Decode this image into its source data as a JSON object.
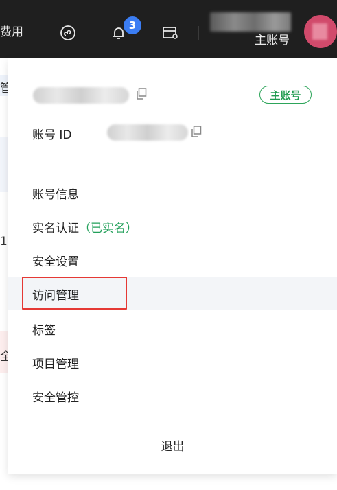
{
  "topbar": {
    "fee_label": "费用",
    "notification_count": "3",
    "account_role": "主账号"
  },
  "background_page": {
    "chars": [
      "管",
      "1",
      "全"
    ]
  },
  "account_panel": {
    "role_tag": "主账号",
    "account_id_label": "账号 ID"
  },
  "menu": {
    "items": [
      {
        "label": "账号信息"
      },
      {
        "label": "实名认证",
        "status": "（已实名）"
      },
      {
        "label": "安全设置"
      },
      {
        "label": "访问管理"
      },
      {
        "label": "标签"
      },
      {
        "label": "项目管理"
      },
      {
        "label": "安全管控"
      }
    ],
    "logout_label": "退出"
  },
  "colors": {
    "topbar_bg": "#1f1f1f",
    "badge": "#3b7df3",
    "verified_green": "#22a05a",
    "highlight_red": "#e53935"
  }
}
